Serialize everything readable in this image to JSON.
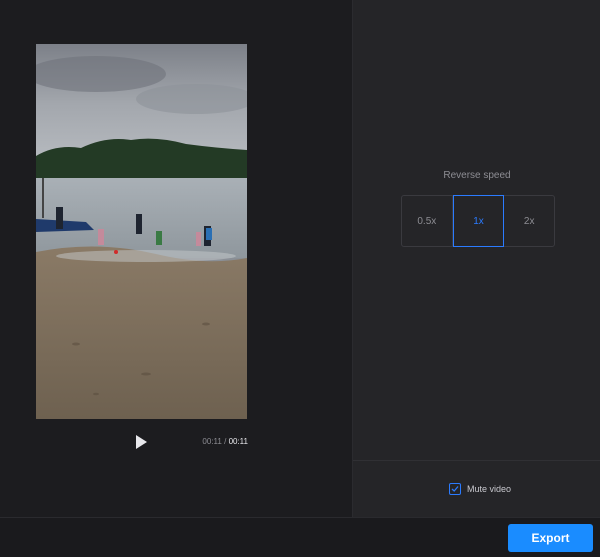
{
  "player": {
    "current_time": "00:11",
    "separator": "/",
    "total_time": "00:11"
  },
  "reverse_speed": {
    "label": "Reverse speed",
    "options": [
      "0.5x",
      "1x",
      "2x"
    ],
    "selected": "1x"
  },
  "mute": {
    "label": "Mute video",
    "checked": true
  },
  "footer": {
    "export_label": "Export"
  },
  "colors": {
    "accent": "#1a8cff",
    "panel_dark": "#1c1c1f",
    "panel_right": "#252528"
  },
  "icons": {
    "play": "play-icon",
    "check": "check-icon"
  }
}
